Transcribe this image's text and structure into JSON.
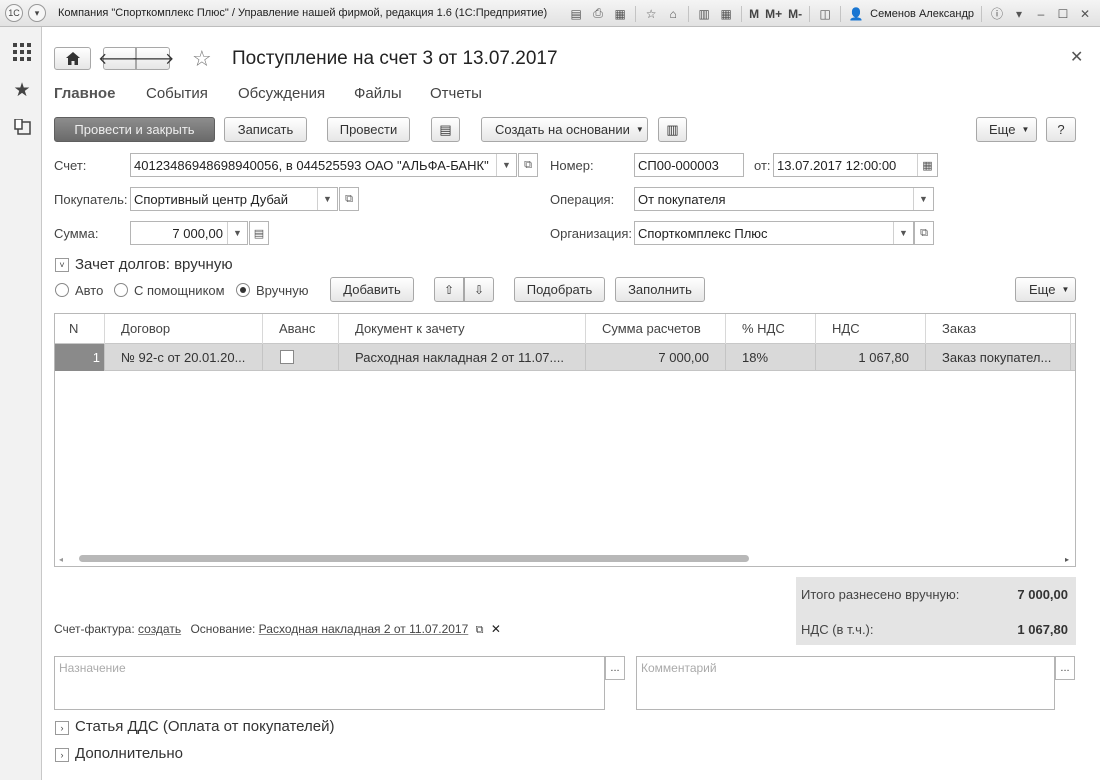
{
  "window": {
    "title": "Компания \"Спорткомплекс Плюс\" / Управление нашей фирмой, редакция 1.6  (1С:Предприятие)",
    "user": "Семенов Александр",
    "mem_m": "M",
    "mem_mplus": "M+",
    "mem_mminus": "M-"
  },
  "form": {
    "title": "Поступление на счет 3 от 13.07.2017",
    "tabs": [
      "Главное",
      "События",
      "Обсуждения",
      "Файлы",
      "Отчеты"
    ],
    "toolbar": {
      "post_close": "Провести и закрыть",
      "save": "Записать",
      "post": "Провести",
      "create_based": "Создать на основании",
      "more": "Еще",
      "help": "?"
    },
    "fields": {
      "account_label": "Счет:",
      "account_value": "40123486948698940056, в 044525593 ОАО \"АЛЬФА-БАНК\"",
      "number_label": "Номер:",
      "number_value": "СП00-000003",
      "date_label": "от:",
      "date_value": "13.07.2017 12:00:00",
      "buyer_label": "Покупатель:",
      "buyer_value": "Спортивный центр Дубай",
      "operation_label": "Операция:",
      "operation_value": "От покупателя",
      "sum_label": "Сумма:",
      "sum_value": "7 000,00",
      "org_label": "Организация:",
      "org_value": "Спорткомплекс Плюс"
    },
    "debt_offset": {
      "title": "Зачет долгов: вручную",
      "radio_auto": "Авто",
      "radio_helper": "С помощником",
      "radio_manual": "Вручную",
      "add": "Добавить",
      "pick": "Подобрать",
      "fill": "Заполнить",
      "more": "Еще"
    },
    "table": {
      "columns": [
        "N",
        "Договор",
        "Аванс",
        "Документ к зачету",
        "Сумма расчетов",
        "% НДС",
        "НДС",
        "Заказ"
      ],
      "rows": [
        {
          "n": "1",
          "contract": "№ 92-с от 20.01.20...",
          "advance": false,
          "document": "Расходная накладная 2 от 11.07....",
          "sum": "7 000,00",
          "vat_rate": "18%",
          "vat": "1 067,80",
          "order": "Заказ покупател..."
        }
      ]
    },
    "totals": {
      "distributed_label": "Итого разнесено вручную:",
      "distributed_value": "7 000,00",
      "vat_label": "НДС (в т.ч.):",
      "vat_value": "1 067,80"
    },
    "invoice": {
      "label": "Счет-фактура:",
      "create_link": "создать",
      "basis_label": "Основание:",
      "basis_link": "Расходная накладная 2 от 11.07.2017"
    },
    "purpose_placeholder": "Назначение",
    "comment_placeholder": "Комментарий",
    "dds_title": "Статья ДДС (Оплата от покупателей)",
    "extra_title": "Дополнительно",
    "ellipsis": "..."
  }
}
